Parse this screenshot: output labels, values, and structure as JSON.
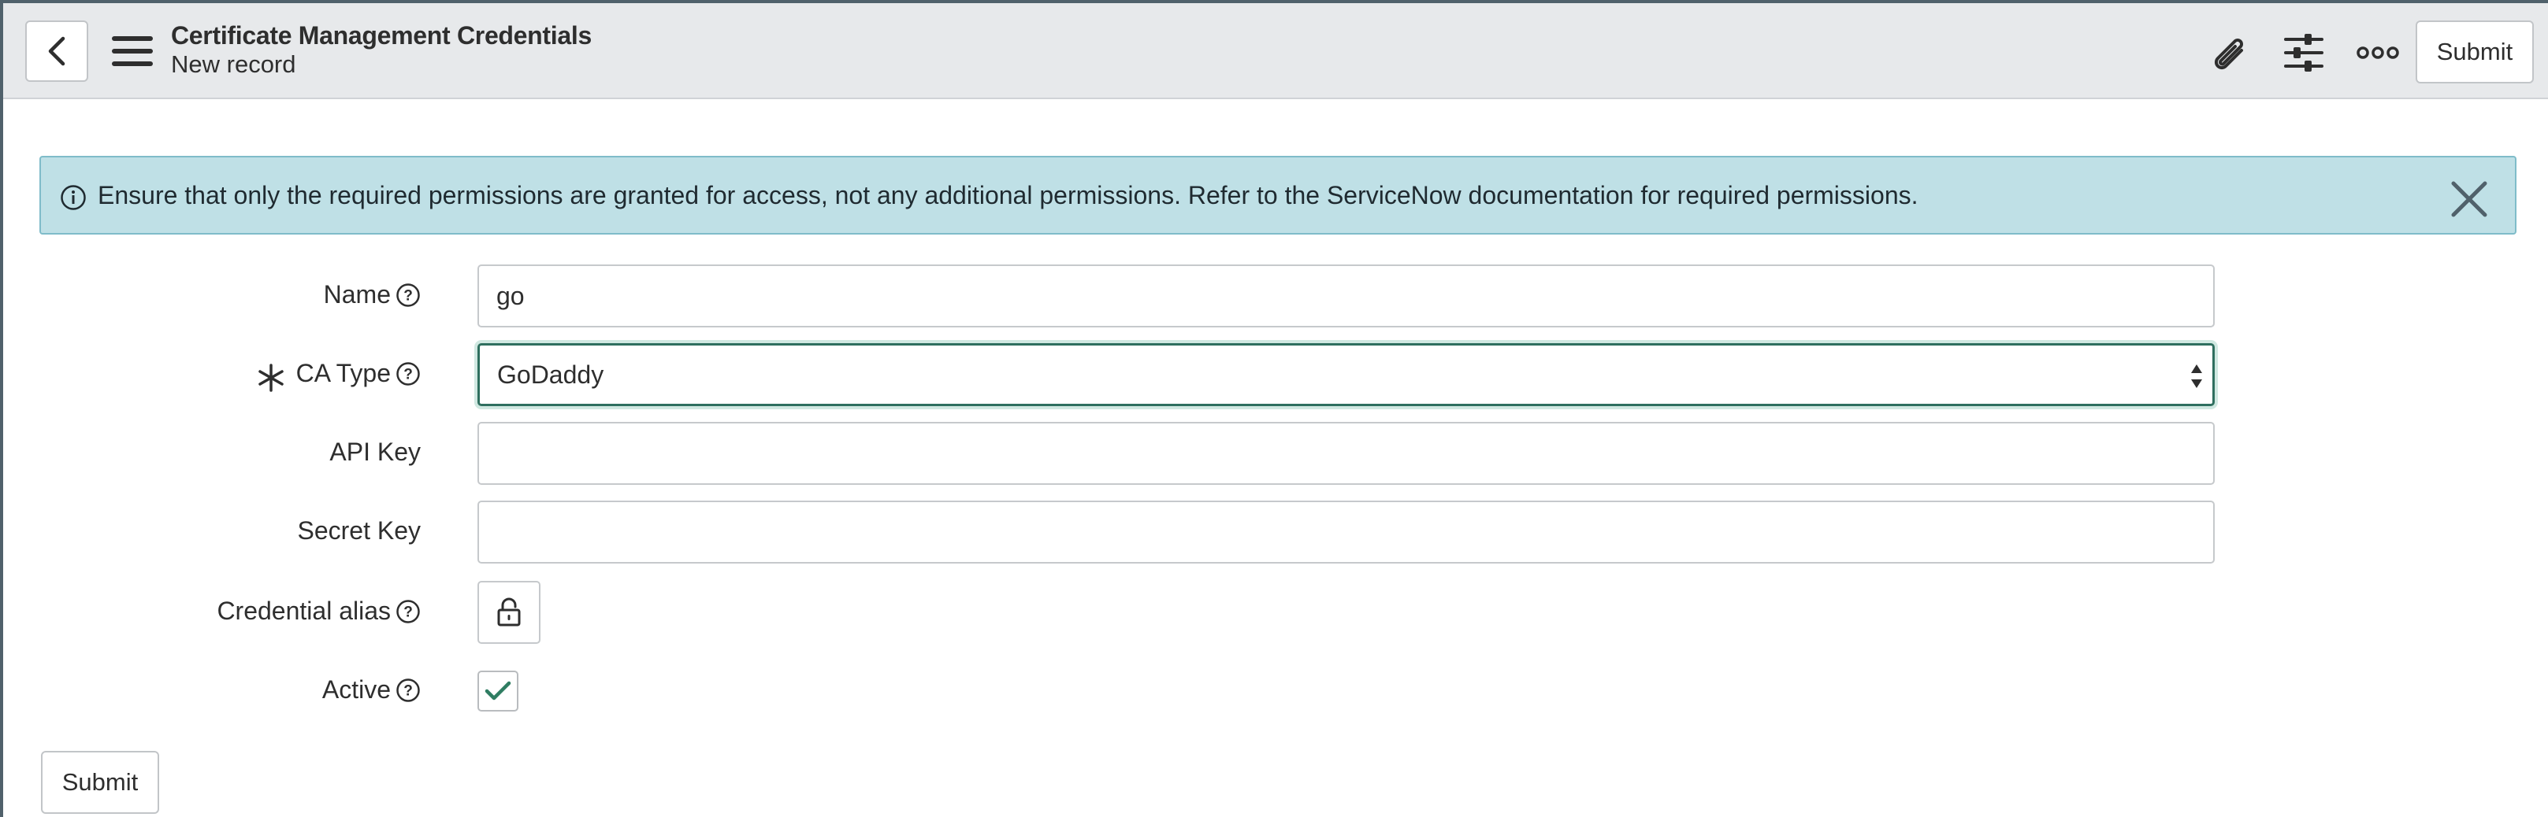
{
  "header": {
    "title": "Certificate Management Credentials",
    "subtitle": "New record",
    "submit_label": "Submit",
    "icons": [
      "back-chevron-icon",
      "hamburger-menu-icon",
      "paperclip-icon",
      "sliders-icon",
      "more-options-icon"
    ]
  },
  "banner": {
    "message": "Ensure that only the required permissions are granted for access, not any additional permissions. Refer to the ServiceNow documentation for required permissions.",
    "background_color": "#bfe0e6"
  },
  "form": {
    "name": {
      "label": "Name",
      "value": "go"
    },
    "ca_type": {
      "label": "CA Type",
      "value": "GoDaddy",
      "required": true
    },
    "api_key": {
      "label": "API Key",
      "value": ""
    },
    "secret_key": {
      "label": "Secret Key",
      "value": ""
    },
    "credential_alias": {
      "label": "Credential alias"
    },
    "active": {
      "label": "Active",
      "checked": true
    }
  },
  "footer": {
    "submit_label": "Submit"
  },
  "colors": {
    "focus_border": "#2f6f5f",
    "check_mark": "#2f7d62",
    "header_bg": "#e7e9eb"
  }
}
